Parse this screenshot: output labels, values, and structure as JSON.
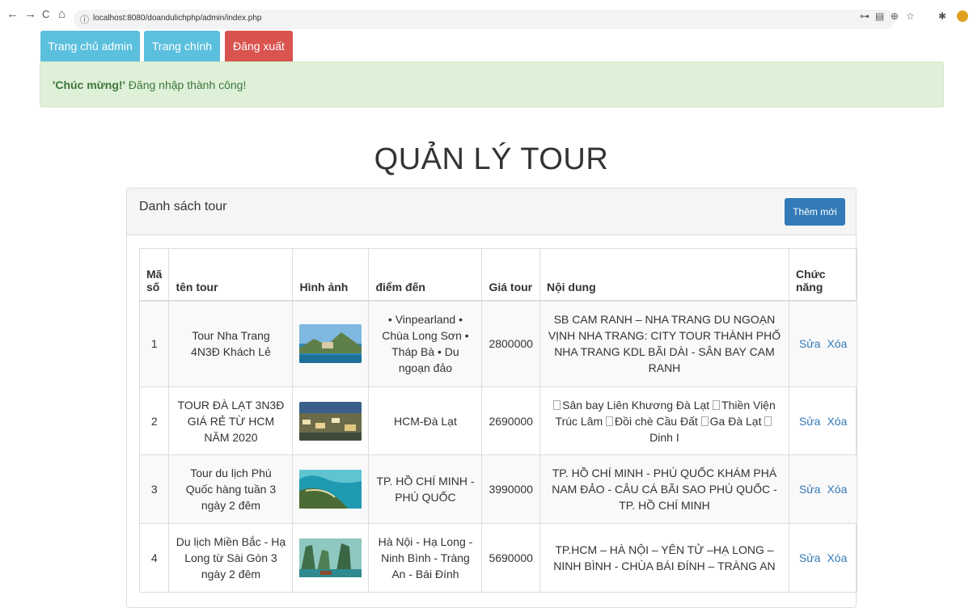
{
  "browser": {
    "url": "localhost:8080/doandulichphp/admin/index.php",
    "nav": {
      "back": "←",
      "forward": "→",
      "reload": "C",
      "home": "⌂",
      "info": "ⓘ"
    },
    "extensions": [
      "⊶",
      "▤",
      "⊕",
      "☆",
      "✱"
    ]
  },
  "top_nav": {
    "admin_home": "Trang chủ admin",
    "main_page": "Trang chính",
    "logout": "Đăng xuất"
  },
  "alert": {
    "strong": "'Chúc mừng!'",
    "message": "Đăng nhập thành công!"
  },
  "page_title": "QUẢN LÝ TOUR",
  "panel": {
    "title": "Danh sách tour",
    "add_button": "Thêm mới"
  },
  "table": {
    "headers": [
      "Mã số",
      "tên tour",
      "Hình ảnh",
      "điểm đến",
      "Giá tour",
      "Nội dung",
      "Chức năng"
    ],
    "edit_label": "Sửa",
    "delete_label": "Xóa",
    "rows": [
      {
        "id": "1",
        "name": "Tour Nha Trang 4N3Đ Khách Lẻ",
        "destination": "• Vinpearland • Chùa Long Sơn • Tháp Bà • Du ngoạn đảo",
        "price": "2800000",
        "content": "SB CAM RANH – NHA TRANG DU NGOẠN VỊNH NHA TRANG: CITY TOUR THÀNH PHỐ NHA TRANG KDL BÃI DÀI - SÂN BAY CAM RANH"
      },
      {
        "id": "2",
        "name": "TOUR ĐÀ LẠT 3N3Đ GIÁ RẺ TỪ HCM NĂM 2020",
        "destination": "HCM-Đà Lạt",
        "price": "2690000",
        "content_parts": [
          "Sân bay Liên Khương Đà Lạt",
          "Thiền Viện Trúc Lâm",
          "Đồi chè Cầu Đất",
          "Ga Đà Lạt",
          "Dinh I"
        ]
      },
      {
        "id": "3",
        "name": "Tour du lịch Phú Quốc hàng tuần 3 ngày 2 đêm",
        "destination": "TP. HỒ CHÍ MINH - PHÚ QUỐC",
        "price": "3990000",
        "content": "TP. HỒ CHÍ MINH - PHÚ QUỐC KHÁM PHÁ NAM ĐẢO - CÂU CÁ BÃI SAO PHÚ QUỐC - TP. HỒ CHÍ MINH"
      },
      {
        "id": "4",
        "name": "Du lịch Miền Bắc - Hạ Long từ Sài Gòn 3 ngày 2 đêm",
        "destination": "Hà Nội - Hạ Long - Ninh Bình - Tràng An - Bái Đính",
        "price": "5690000",
        "content": "TP.HCM – HÀ NỘI – YÊN TỬ –HẠ LONG – NINH BÌNH - CHÙA BÁI ĐÍNH – TRÀNG AN"
      }
    ]
  }
}
